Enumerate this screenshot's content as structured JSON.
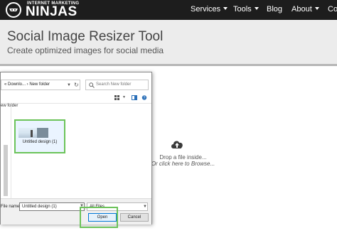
{
  "nav": {
    "logo_small": "INTERNET MARKETING",
    "logo_big": "NINJAS",
    "items": [
      {
        "label": "Services",
        "caret": true
      },
      {
        "label": "Tools",
        "caret": true
      },
      {
        "label": "Blog",
        "caret": false
      },
      {
        "label": "About",
        "caret": true
      },
      {
        "label": "Co",
        "caret": false
      }
    ]
  },
  "header": {
    "title": "Social Image Resizer Tool",
    "subtitle": "Create optimized images for social media"
  },
  "dropzone": {
    "icon": "cloud-upload-icon",
    "main_text": "Drop a file inside...",
    "sub_text": "Or click here to Browse..."
  },
  "dialog": {
    "path": "« Downlo... › New folder",
    "search_placeholder": "Search New folder",
    "folder_label": "ew folder",
    "files": [
      {
        "name": "Untitled design (1)"
      }
    ],
    "file_name_label": "File name:",
    "file_name_value": "Untitled design (1)",
    "file_type": "All Files",
    "open_label": "Open",
    "cancel_label": "Cancel"
  },
  "colors": {
    "nav_bg": "#1d1d1d",
    "header_bg": "#ececec",
    "highlight": "#6cc35a",
    "accent_blue": "#0078d7"
  }
}
